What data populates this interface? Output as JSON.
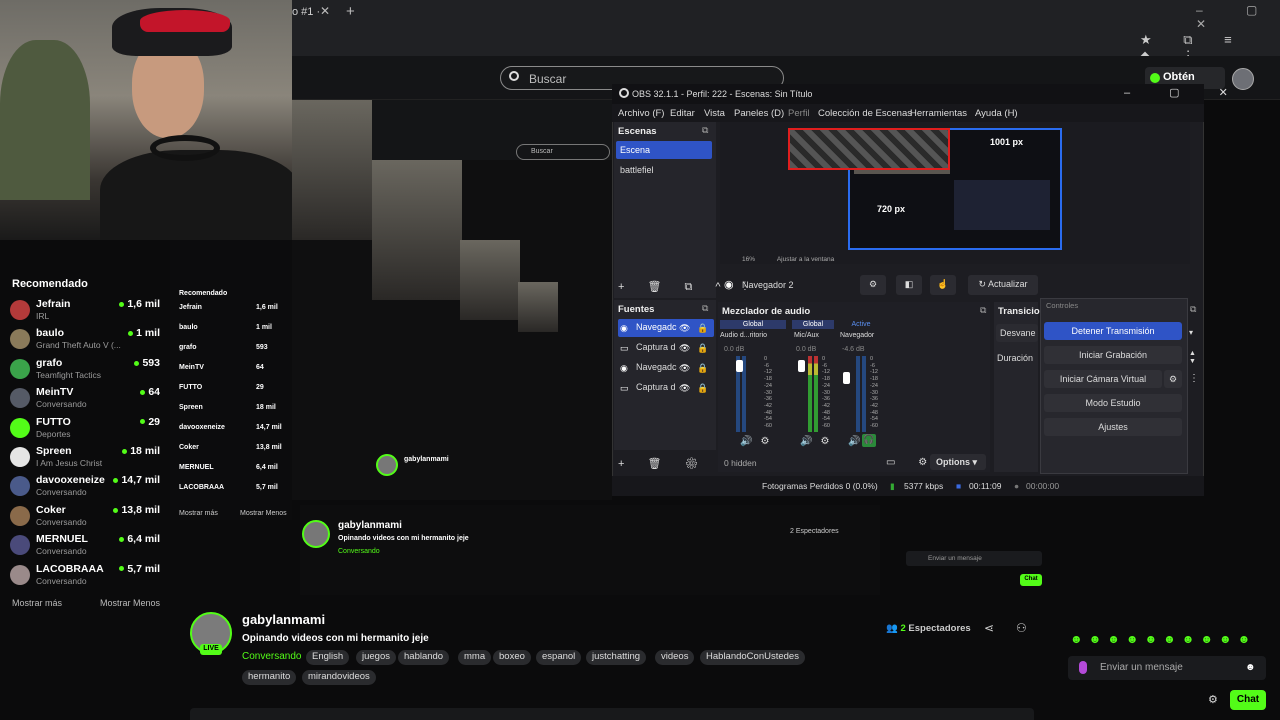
{
  "browser": {
    "tab_text": "o #1 ·",
    "tab_close": "✕",
    "new_tab": "+",
    "window_controls": "–  ▢  ✕",
    "toolbar_icons": "★ ⧉ ≡ ◆ ⋮"
  },
  "kick": {
    "search_placeholder": "Buscar",
    "kicks_label": "Obtén KICKs"
  },
  "sidebar": {
    "title": "Recomendado",
    "show_more": "Mostrar más",
    "show_less": "Mostrar Menos",
    "items": [
      {
        "name": "Jefrain",
        "sub": "IRL",
        "count": "1,6 mil",
        "color": "#b33a3a"
      },
      {
        "name": "baulo",
        "sub": "Grand Theft Auto V (...",
        "count": "1 mil",
        "color": "#8a7a5a"
      },
      {
        "name": "grafo",
        "sub": "Teamfight Tactics",
        "count": "593",
        "color": "#3aa34a"
      },
      {
        "name": "MeinTV",
        "sub": "Conversando",
        "count": "64",
        "color": "#555a66"
      },
      {
        "name": "FUTTO",
        "sub": "Deportes",
        "count": "29",
        "color": "#53fc18"
      },
      {
        "name": "Spreen",
        "sub": "I Am Jesus Christ",
        "count": "18 mil",
        "color": "#e5e5e5"
      },
      {
        "name": "davooxeneize",
        "sub": "Conversando",
        "count": "14,7 mil",
        "color": "#4a5a8a"
      },
      {
        "name": "Coker",
        "sub": "Conversando",
        "count": "13,8 mil",
        "color": "#8a6a4a"
      },
      {
        "name": "MERNUEL",
        "sub": "Conversando",
        "count": "6,4 mil",
        "color": "#4a4a7a"
      },
      {
        "name": "LACOBRAAA",
        "sub": "Conversando",
        "count": "5,7 mil",
        "color": "#9a8a8a"
      }
    ]
  },
  "obs": {
    "title": "OBS 32.1.1 - Perfil: 222 - Escenas: Sin Título",
    "window_controls": "–  ▢  ✕",
    "menu": [
      "Archivo (F)",
      "Editar",
      "Vista",
      "Paneles (D)",
      "Perfil",
      "Colección de Escenas",
      "Herramientas",
      "Ayuda (H)"
    ],
    "scenes_title": "Escenas",
    "scenes": [
      "Escena",
      "battlefiel"
    ],
    "preview_px_1": "1001 px",
    "preview_px_2": "720 px",
    "zoom": "16%",
    "zoom_fit": "Ajustar a la ventana",
    "source_name": "Navegador 2",
    "refresh_label": "Actualizar",
    "sources_title": "Fuentes",
    "sources": [
      "Navegadc",
      "Captura d",
      "Navegadc",
      "Captura d"
    ],
    "hidden_label": "0 hidden",
    "mixer_title": "Mezclador de audio",
    "mixer_tabs": [
      "Global",
      "Global",
      "Active"
    ],
    "mixer_channels": [
      "Audio d...ritorio",
      "Mic/Aux",
      "Navegador"
    ],
    "mixer_db": [
      "0.0 dB",
      "0.0 dB",
      "-4.6 dB"
    ],
    "mixer_scale": "0\n-6\n-12\n-18\n-24\n-30\n-36\n-42\n-48\n-54\n-60",
    "options_label": "Options",
    "transitions_title": "Transicio",
    "transition_value": "Desvane",
    "duration_label": "Duración",
    "controls_title": "Controles",
    "controls": [
      "Detener Transmisión",
      "Iniciar Grabación",
      "Iniciar Cámara Virtual",
      "Modo Estudio",
      "Ajustes"
    ],
    "status_dropped": "Fotogramas Perdidos 0 (0.0%)",
    "status_kbps": "5377 kbps",
    "status_time": "00:11:09",
    "status_rec": "00:00:00"
  },
  "stream": {
    "name": "gabylanmami",
    "title": "Opinando videos con mi hermanito jeje",
    "category": "Conversando",
    "live": "LIVE",
    "tags": [
      "English",
      "juegos",
      "hablando",
      "mma",
      "boxeo",
      "espanol",
      "justchatting",
      "videos",
      "HablandoConUstedes",
      "hermanito",
      "mirandovideos"
    ],
    "viewers_num": "2",
    "viewers_label": "Espectadores"
  },
  "chat": {
    "emotes": "☻☻☻☻☻☻☻☻☻☻",
    "input_placeholder": "Enviar un mensaje",
    "emoji_icon": "☻",
    "send_label": "Chat"
  },
  "colors": {
    "kick_green": "#53fc18",
    "obs_blue": "#2f54c6",
    "obs_selection_red": "#e01e1e"
  },
  "icons": [
    "search-icon",
    "kicks-coin-icon",
    "gear-icon",
    "eye-icon",
    "lock-icon",
    "speaker-icon",
    "headphones-icon",
    "share-icon",
    "user-add-icon",
    "mic-icon",
    "emoji-icon"
  ]
}
